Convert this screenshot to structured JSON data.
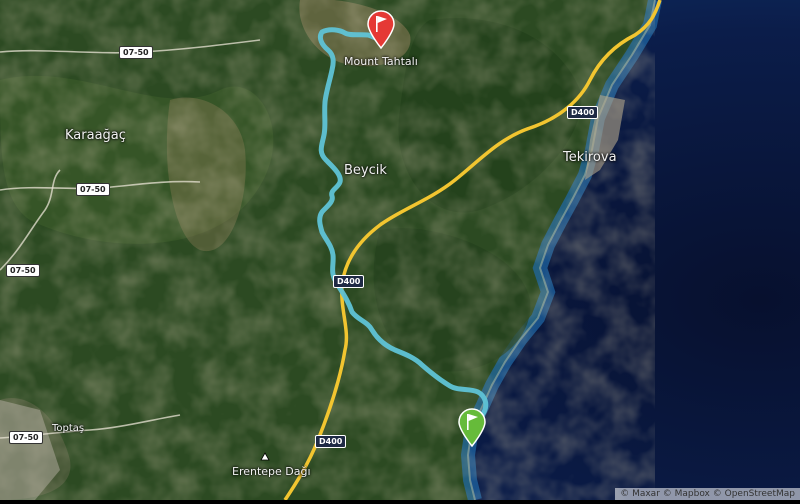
{
  "map": {
    "places": [
      {
        "id": "mount-tahtali",
        "label": "Mount Tahtalı",
        "kind": "peak"
      },
      {
        "id": "karaagac",
        "label": "Karaağaç",
        "kind": "village"
      },
      {
        "id": "beycik",
        "label": "Beycik",
        "kind": "village"
      },
      {
        "id": "tekirova",
        "label": "Tekirova",
        "kind": "town"
      },
      {
        "id": "toptas",
        "label": "Toptaş",
        "kind": "hamlet"
      },
      {
        "id": "erentepe",
        "label": "Erentepe Dağı",
        "kind": "peak"
      }
    ],
    "road_shields": {
      "r1": "07-50",
      "r2": "07-50",
      "r3": "07-50",
      "r4": "07-50",
      "d1": "D400",
      "d2": "D400",
      "d3": "D400"
    },
    "markers": {
      "finish": {
        "type": "finish",
        "color": "#e53935",
        "icon": "flag-icon"
      },
      "start": {
        "type": "start",
        "color": "#66bb3a",
        "icon": "flag-icon"
      }
    },
    "route_color": "#5fc3d6",
    "road_color": "#f2c530",
    "attribution": "© Maxar © Mapbox © OpenStreetMap"
  }
}
